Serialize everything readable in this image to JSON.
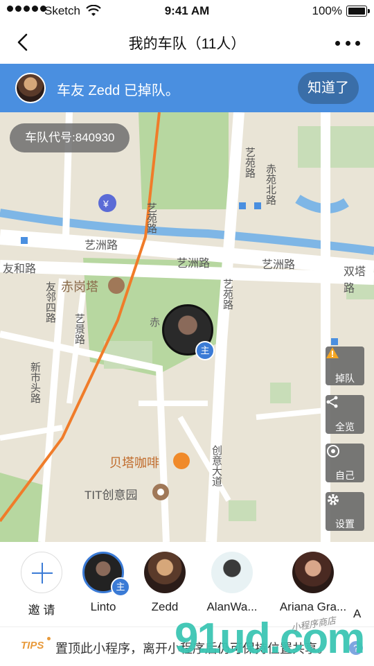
{
  "status_bar": {
    "carrier": "Sketch",
    "time": "9:41 AM",
    "battery": "100%"
  },
  "nav": {
    "title": "我的车队（11人）"
  },
  "banner": {
    "message": "车友 Zedd 已掉队。",
    "ack_label": "知道了"
  },
  "map": {
    "team_code": "车队代号:840930",
    "labels": {
      "road_yizhou_1": "艺洲路",
      "road_yizhou_2": "艺洲路",
      "road_yizhou_3": "艺洲路",
      "road_youhe": "友和路",
      "road_yiyuan_1": "艺苑路",
      "road_yiyuan_2": "艺苑路",
      "road_yiyuan_3": "艺苑路",
      "road_youlinsi": "友邻四路",
      "road_yijing": "艺景路",
      "road_xinshitou": "新市头路",
      "road_chiyuanbei": "赤苑北路",
      "road_shuangta": "双塔路",
      "road_chuangyi": "创意大道",
      "poi_chigangta": "赤岗塔",
      "poi_chi": "赤",
      "poi_beita": "贝塔咖啡",
      "poi_tit": "TIT创意园"
    },
    "buttons": [
      {
        "label": "掉队",
        "icon": "warning-icon"
      },
      {
        "label": "全览",
        "icon": "share-nodes-icon"
      },
      {
        "label": "自己",
        "icon": "locate-icon"
      },
      {
        "label": "设置",
        "icon": "gear-icon"
      }
    ],
    "owner_badge": "主"
  },
  "members": [
    {
      "name": "邀 请"
    },
    {
      "name": "Linto",
      "badge": "主"
    },
    {
      "name": "Zedd"
    },
    {
      "name": "AlanWa..."
    },
    {
      "name": "Ariana Gra..."
    },
    {
      "name": "A"
    }
  ],
  "tips": {
    "badge": "TIPS",
    "text": "置顶此小程序，离开小程序后仍可保持位置共享。",
    "help": "?"
  },
  "watermark": {
    "main": "91ud.com",
    "sub": "小程序商店"
  },
  "colors": {
    "accent": "#4a8fe0",
    "primary": "#3b7bd6",
    "tips": "#e89a3b",
    "warning": "#f5a623"
  }
}
